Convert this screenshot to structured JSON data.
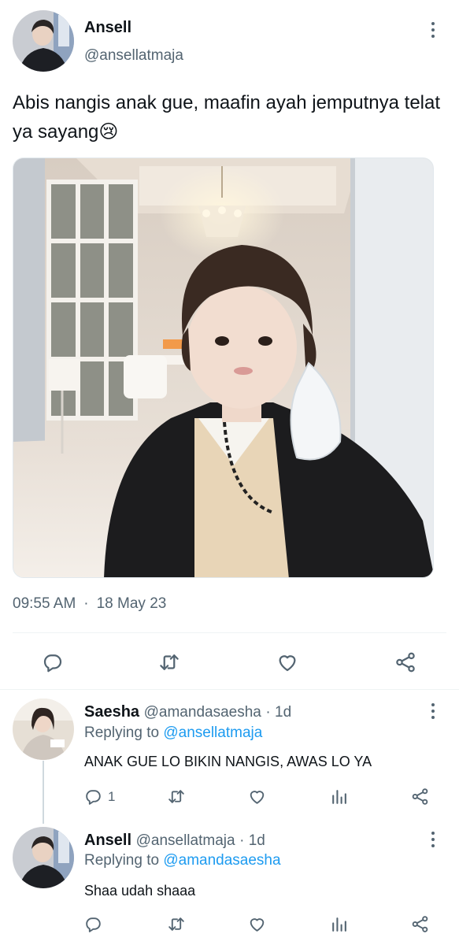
{
  "main_tweet": {
    "author_name": "Ansell",
    "author_handle": "@ansellatmaja",
    "text": "Abis nangis anak gue, maafin ayah jemputnya telat ya sayang",
    "emoji": "😢",
    "time": "09:55 AM",
    "separator": "·",
    "date": "18 May 23"
  },
  "replies": [
    {
      "author_name": "Saesha",
      "author_handle": "@amandasaesha",
      "age": "· 1d",
      "replying_prefix": "Replying to",
      "replying_to": "@ansellatmaja",
      "text": "ANAK GUE LO BIKIN NANGIS, AWAS LO YA",
      "reply_count": "1"
    },
    {
      "author_name": "Ansell",
      "author_handle": "@ansellatmaja",
      "age": "· 1d",
      "replying_prefix": "Replying to",
      "replying_to": "@amandasaesha",
      "text": "Shaa udah shaaa",
      "reply_count": ""
    }
  ],
  "colors": {
    "text": "#0f1419",
    "muted": "#536471",
    "link": "#1d9bf0",
    "divider": "#eff3f4"
  }
}
